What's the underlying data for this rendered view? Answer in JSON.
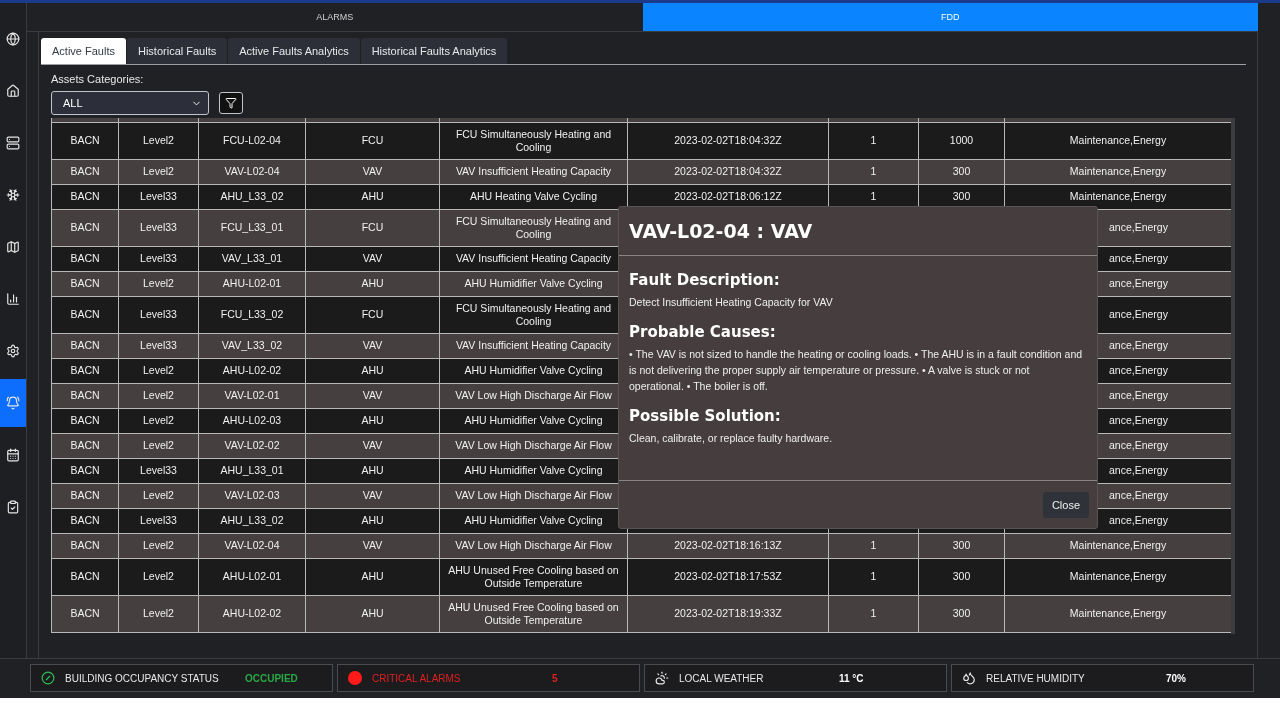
{
  "sidebar": {
    "items": [
      {
        "selected": false
      },
      {
        "selected": false
      },
      {
        "selected": false
      },
      {
        "selected": false
      },
      {
        "selected": false
      },
      {
        "selected": false
      },
      {
        "selected": false
      },
      {
        "selected": true
      },
      {
        "selected": false
      },
      {
        "selected": false
      }
    ]
  },
  "top_tabs": [
    {
      "label": "ALARMS",
      "selected": false
    },
    {
      "label": "FDD",
      "selected": true
    }
  ],
  "tabs": [
    {
      "label": "Active Faults",
      "selected": true
    },
    {
      "label": "Historical Faults",
      "selected": false
    },
    {
      "label": "Active Faults Analytics",
      "selected": false
    },
    {
      "label": "Historical Faults Analytics",
      "selected": false
    }
  ],
  "filter": {
    "label": "Assets Categories:",
    "value": "ALL"
  },
  "table": {
    "rows": [
      {
        "under_dialog": false,
        "cells": [
          "BACN",
          "Level2",
          "FCU-L02-04",
          "FCU",
          "FCU Simultaneously Heating and Cooling",
          "2023-02-02T18:04:32Z",
          "1",
          "1000",
          "Maintenance,Energy"
        ]
      },
      {
        "under_dialog": false,
        "cells": [
          "BACN",
          "Level2",
          "VAV-L02-04",
          "VAV",
          "VAV Insufficient Heating Capacity",
          "2023-02-02T18:04:32Z",
          "1",
          "300",
          "Maintenance,Energy"
        ]
      },
      {
        "under_dialog": false,
        "cells": [
          "BACN",
          "Level33",
          "AHU_L33_02",
          "AHU",
          "AHU Heating Valve Cycling",
          "2023-02-02T18:06:12Z",
          "1",
          "300",
          "Maintenance,Energy"
        ]
      },
      {
        "under_dialog": true,
        "cells": [
          "BACN",
          "Level33",
          "FCU_L33_01",
          "FCU",
          "FCU Simultaneously Heating and Cooling",
          null,
          null,
          null,
          "ance,Energy"
        ]
      },
      {
        "under_dialog": true,
        "cells": [
          "BACN",
          "Level33",
          "VAV_L33_01",
          "VAV",
          "VAV Insufficient Heating Capacity",
          null,
          null,
          null,
          "ance,Energy"
        ]
      },
      {
        "under_dialog": true,
        "cells": [
          "BACN",
          "Level2",
          "AHU-L02-01",
          "AHU",
          "AHU Humidifier Valve Cycling",
          null,
          null,
          null,
          "ance,Energy"
        ]
      },
      {
        "under_dialog": true,
        "cells": [
          "BACN",
          "Level33",
          "FCU_L33_02",
          "FCU",
          "FCU Simultaneously Heating and Cooling",
          null,
          null,
          null,
          "ance,Energy"
        ]
      },
      {
        "under_dialog": true,
        "cells": [
          "BACN",
          "Level33",
          "VAV_L33_02",
          "VAV",
          "VAV Insufficient Heating Capacity",
          null,
          null,
          null,
          "ance,Energy"
        ]
      },
      {
        "under_dialog": true,
        "cells": [
          "BACN",
          "Level2",
          "AHU-L02-02",
          "AHU",
          "AHU Humidifier Valve Cycling",
          null,
          null,
          null,
          "ance,Energy"
        ]
      },
      {
        "under_dialog": true,
        "cells": [
          "BACN",
          "Level2",
          "VAV-L02-01",
          "VAV",
          "VAV Low High Discharge Air Flow",
          null,
          null,
          null,
          "ance,Energy"
        ]
      },
      {
        "under_dialog": true,
        "cells": [
          "BACN",
          "Level2",
          "AHU-L02-03",
          "AHU",
          "AHU Humidifier Valve Cycling",
          null,
          null,
          null,
          "ance,Energy"
        ]
      },
      {
        "under_dialog": true,
        "cells": [
          "BACN",
          "Level2",
          "VAV-L02-02",
          "VAV",
          "VAV Low High Discharge Air Flow",
          null,
          null,
          null,
          "ance,Energy"
        ]
      },
      {
        "under_dialog": true,
        "cells": [
          "BACN",
          "Level33",
          "AHU_L33_01",
          "AHU",
          "AHU Humidifier Valve Cycling",
          null,
          null,
          null,
          "ance,Energy"
        ]
      },
      {
        "under_dialog": true,
        "cells": [
          "BACN",
          "Level2",
          "VAV-L02-03",
          "VAV",
          "VAV Low High Discharge Air Flow",
          null,
          null,
          null,
          "ance,Energy"
        ]
      },
      {
        "under_dialog": true,
        "cells": [
          "BACN",
          "Level33",
          "AHU_L33_02",
          "AHU",
          "AHU Humidifier Valve Cycling",
          null,
          null,
          null,
          "ance,Energy"
        ]
      },
      {
        "under_dialog": false,
        "cells": [
          "BACN",
          "Level2",
          "VAV-L02-04",
          "VAV",
          "VAV Low High Discharge Air Flow",
          "2023-02-02T18:16:13Z",
          "1",
          "300",
          "Maintenance,Energy"
        ]
      },
      {
        "under_dialog": false,
        "cells": [
          "BACN",
          "Level2",
          "AHU-L02-01",
          "AHU",
          "AHU Unused Free Cooling based on Outside Temperature",
          "2023-02-02T18:17:53Z",
          "1",
          "300",
          "Maintenance,Energy"
        ]
      },
      {
        "under_dialog": false,
        "cells": [
          "BACN",
          "Level2",
          "AHU-L02-02",
          "AHU",
          "AHU Unused Free Cooling based on Outside Temperature",
          "2023-02-02T18:19:33Z",
          "1",
          "300",
          "Maintenance,Energy"
        ]
      }
    ]
  },
  "dialog": {
    "title": "VAV-L02-04 : VAV",
    "sections": [
      {
        "heading": "Fault Description:",
        "text": "Detect Insufficient Heating Capacity for VAV"
      },
      {
        "heading": "Probable Causes:",
        "text": "• The VAV is not sized to handle the heating or cooling loads. • The AHU is in a fault condition and is not delivering the proper supply air temperature or pressure. • A valve is stuck or not operational. • The boiler is off."
      },
      {
        "heading": "Possible Solution:",
        "text": "Clean, calibrate, or replace faulty hardware."
      }
    ],
    "button": "Close"
  },
  "status_bar": [
    {
      "kind": "occupancy",
      "label": "BUILDING OCCUPANCY STATUS",
      "value": "OCCUPIED"
    },
    {
      "kind": "alarm",
      "label": "CRITICAL ALARMS",
      "value": "5"
    },
    {
      "kind": "weather",
      "label": "LOCAL WEATHER",
      "value": "11 °C"
    },
    {
      "kind": "humidity",
      "label": "RELATIVE HUMIDITY",
      "value": "70%"
    }
  ]
}
